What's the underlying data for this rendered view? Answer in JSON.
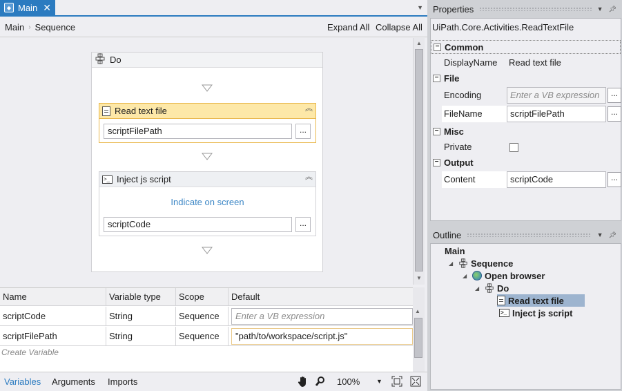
{
  "document_tab": {
    "label": "Main",
    "close": "✕"
  },
  "breadcrumb": {
    "items": [
      "Main",
      "Sequence"
    ]
  },
  "toolbar": {
    "expand_all": "Expand All",
    "collapse_all": "Collapse All"
  },
  "sequence": {
    "title": "Do",
    "activities": [
      {
        "title": "Read text file",
        "field_value": "scriptFilePath",
        "dots": "..."
      },
      {
        "title": "Inject js script",
        "link": "Indicate on screen",
        "field_value": "scriptCode",
        "dots": "..."
      }
    ]
  },
  "variables": {
    "headers": [
      "Name",
      "Variable type",
      "Scope",
      "Default"
    ],
    "rows": [
      {
        "name": "scriptCode",
        "type": "String",
        "scope": "Sequence",
        "default": "Enter a VB expression"
      },
      {
        "name": "scriptFilePath",
        "type": "String",
        "scope": "Sequence",
        "default": "\"path/to/workspace/script.js\""
      }
    ],
    "create": "Create Variable"
  },
  "bottom_tabs": [
    "Variables",
    "Arguments",
    "Imports"
  ],
  "zoom": "100%",
  "properties": {
    "title": "Properties",
    "type_name": "UiPath.Core.Activities.ReadTextFile",
    "categories": {
      "common": "Common",
      "file": "File",
      "misc": "Misc",
      "output": "Output"
    },
    "rows": {
      "display_name": {
        "label": "DisplayName",
        "value": "Read text file"
      },
      "encoding": {
        "label": "Encoding",
        "value": "Enter a VB expression"
      },
      "file_name": {
        "label": "FileName",
        "value": "scriptFilePath"
      },
      "private": {
        "label": "Private"
      },
      "content": {
        "label": "Content",
        "value": "scriptCode"
      }
    },
    "dots": "..."
  },
  "outline": {
    "title": "Outline",
    "nodes": [
      "Main",
      "Sequence",
      "Open browser",
      "Do",
      "Read text file",
      "Inject js script"
    ]
  },
  "colors": {
    "accent": "#2b7bc0",
    "selected_activity": "#fde8a8",
    "link": "#3b86c5"
  },
  "icons": [
    "sequence-icon",
    "document-icon",
    "terminal-icon",
    "globe-icon",
    "hand-icon",
    "magnifier-icon",
    "fit-screen-icon",
    "overview-icon",
    "pin-icon"
  ]
}
